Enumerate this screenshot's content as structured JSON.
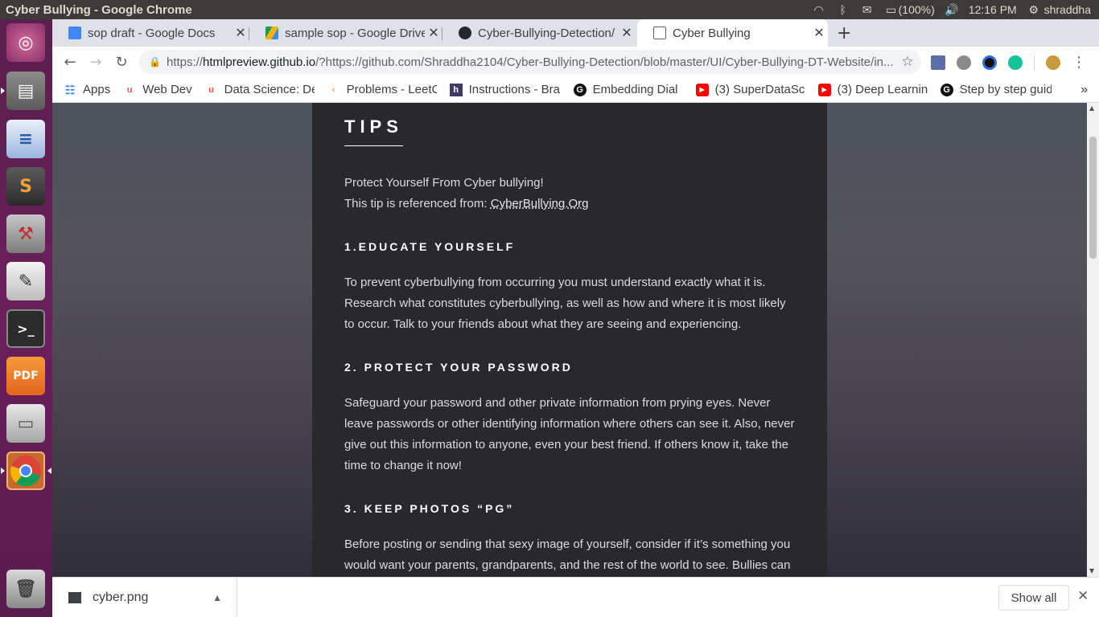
{
  "system_bar": {
    "window_title": "Cyber Bullying - Google Chrome",
    "battery": "(100%)",
    "time": "12:16 PM",
    "user": "shraddha"
  },
  "launcher": {
    "apps": [
      "ubuntu-logo-icon",
      "files-icon",
      "writer-icon",
      "sublime-text-icon",
      "settings-icon",
      "text-editor-icon",
      "terminal-icon",
      "foxit-pdf-icon",
      "disk-icon",
      "chrome-icon",
      "trash-icon"
    ]
  },
  "tabs": [
    {
      "label": "sop draft - Google Docs",
      "color": "#4285f4"
    },
    {
      "label": "sample sop - Google Drive",
      "color": "#0f9d58"
    },
    {
      "label": "Cyber-Bullying-Detection/",
      "color": "#24292e"
    },
    {
      "label": "Cyber Bullying",
      "color": "#ffffff"
    }
  ],
  "address_bar": {
    "url_prefix": "https://",
    "url_host": "htmlpreview.github.io",
    "url_rest": "/?https://github.com/Shraddha2104/Cyber-Bullying-Detection/blob/master/UI/Cyber-Bullying-DT-Website/in..."
  },
  "bookmarks": [
    {
      "label": "Apps",
      "icon": "apps-grid-icon"
    },
    {
      "label": "Web Dev",
      "icon": "udemy-icon"
    },
    {
      "label": "Data Science: De",
      "icon": "udemy-icon"
    },
    {
      "label": "Problems - LeetC",
      "icon": "leetcode-icon"
    },
    {
      "label": "Instructions - Bra",
      "icon": "h-icon"
    },
    {
      "label": "Embedding Dial",
      "icon": "g-icon"
    },
    {
      "label": "(3) SuperDataSci",
      "icon": "youtube-icon"
    },
    {
      "label": "(3) Deep Learnin",
      "icon": "youtube-icon"
    },
    {
      "label": "Step by step guid",
      "icon": "g-icon"
    }
  ],
  "page": {
    "heading": "TIPS",
    "intro_line1": "Protect Yourself From Cyber bullying!",
    "intro_line2": "This tip is referenced from: ",
    "intro_link": "CyberBullying.Org",
    "sections": [
      {
        "title": "1.EDUCATE YOURSELF",
        "body": "To prevent cyberbullying from occurring you must understand exactly what it is. Research what constitutes cyberbullying, as well as how and where it is most likely to occur. Talk to your friends about what they are seeing and experiencing."
      },
      {
        "title": "2. PROTECT YOUR PASSWORD",
        "body": "Safeguard your password and other private information from prying eyes. Never leave passwords or other identifying information where others can see it. Also, never give out this information to anyone, even your best friend. If others know it, take the time to change it now!"
      },
      {
        "title": "3. KEEP PHOTOS “PG”",
        "body": "Before posting or sending that sexy image of yourself, consider if it’s something you would want your parents, grandparents, and the rest of the world to see. Bullies can"
      }
    ]
  },
  "downloads": {
    "file": "cyber.png",
    "show_all": "Show all"
  }
}
